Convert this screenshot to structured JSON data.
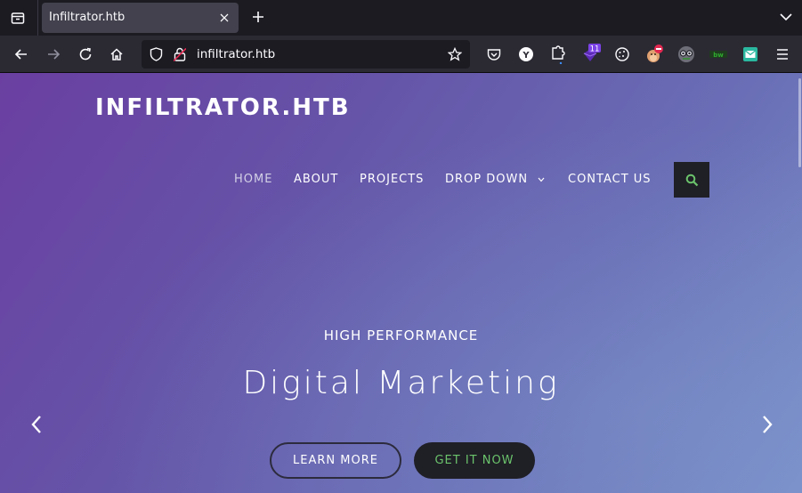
{
  "browser": {
    "tab": {
      "title": "Infiltrator.htb"
    },
    "url": "infiltrator.htb",
    "extensions": [
      {
        "name": "pocket-icon"
      },
      {
        "name": "yandex-icon",
        "label": "Y"
      },
      {
        "name": "extensions-icon"
      },
      {
        "name": "badge-extension-icon",
        "badge": "11"
      },
      {
        "name": "cookie-icon"
      },
      {
        "name": "mascot-extension-icon"
      },
      {
        "name": "spy-glasses-icon"
      },
      {
        "name": "green-extension-icon",
        "label": "bw"
      },
      {
        "name": "mail-extension-icon"
      }
    ]
  },
  "site": {
    "brand": "INFILTRATOR.HTB",
    "menu": {
      "home": "HOME",
      "about": "ABOUT",
      "projects": "PROJECTS",
      "dropdown": "DROP DOWN",
      "contact": "CONTACT US"
    },
    "hero": {
      "subtitle": "HIGH PERFORMANCE",
      "title": "Digital Marketing",
      "learn_more": "LEARN MORE",
      "get_it_now": "GET IT NOW"
    }
  },
  "colors": {
    "accent_green": "#6bc36b",
    "hero_gradient_start": "#6a3fa1",
    "hero_gradient_end": "#7a8fc9"
  }
}
